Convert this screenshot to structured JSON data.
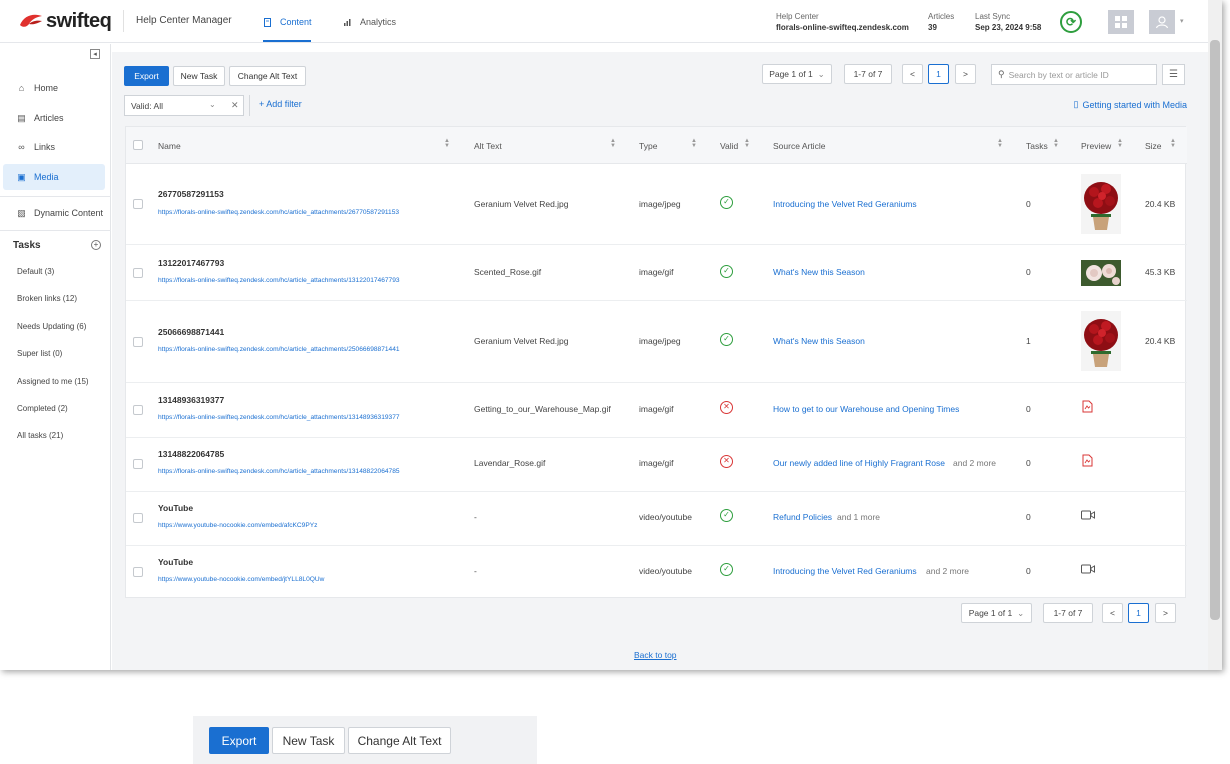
{
  "header": {
    "logo_text": "swifteq",
    "app_title": "Help Center Manager",
    "tabs": [
      {
        "label": "Content"
      },
      {
        "label": "Analytics"
      }
    ],
    "help_center": {
      "label": "Help Center",
      "value": "florals-online-swifteq.zendesk.com"
    },
    "articles": {
      "label": "Articles",
      "value": "39"
    },
    "last_sync": {
      "label": "Last Sync",
      "value": "Sep 23, 2024 9:58"
    }
  },
  "sidebar": {
    "collapse_icon": "◂",
    "items": [
      {
        "label": "Home",
        "icon": "home-icon"
      },
      {
        "label": "Articles",
        "icon": "article-icon"
      },
      {
        "label": "Links",
        "icon": "link-icon"
      },
      {
        "label": "Media",
        "icon": "media-icon"
      },
      {
        "label": "Dynamic Content",
        "icon": "dynamic-content-icon"
      }
    ],
    "tasks_title": "Tasks",
    "tasks": [
      {
        "label": "Default (3)"
      },
      {
        "label": "Broken links (12)"
      },
      {
        "label": "Needs Updating (6)"
      },
      {
        "label": "Super list (0)"
      },
      {
        "label": "Assigned to me (15)"
      },
      {
        "label": "Completed (2)"
      },
      {
        "label": "All tasks (21)"
      }
    ]
  },
  "toolbar": {
    "export_label": "Export",
    "new_task_label": "New Task",
    "change_alt_label": "Change Alt Text",
    "page_select": "Page 1 of 1",
    "range": "1-7 of 7",
    "prev": "<",
    "current_page": "1",
    "next": ">",
    "search_placeholder": "Search by text or article ID"
  },
  "filters": {
    "valid_value": "Valid: All",
    "add_filter_label": "+ Add filter",
    "getting_started_label": "Getting started with Media"
  },
  "table": {
    "columns": {
      "name": "Name",
      "alt": "Alt Text",
      "type": "Type",
      "valid": "Valid",
      "source": "Source Article",
      "tasks": "Tasks",
      "preview": "Preview",
      "size": "Size"
    },
    "rows": [
      {
        "id": "26770587291153",
        "url": "https://florals-online-swifteq.zendesk.com/hc/article_attachments/26770587291153",
        "alt": "Geranium Velvet Red.jpg",
        "type": "image/jpeg",
        "valid": true,
        "source": "Introducing the Velvet Red Geraniums",
        "more": "",
        "tasks": "0",
        "preview": "red-geranium-thumbnail",
        "size": "20.4 KB"
      },
      {
        "id": "13122017467793",
        "url": "https://florals-online-swifteq.zendesk.com/hc/article_attachments/13122017467793",
        "alt": "Scented_Rose.gif",
        "type": "image/gif",
        "valid": true,
        "source": "What's New this Season",
        "more": "",
        "tasks": "0",
        "preview": "white-rose-thumbnail",
        "size": "45.3 KB"
      },
      {
        "id": "25066698871441",
        "url": "https://florals-online-swifteq.zendesk.com/hc/article_attachments/25066698871441",
        "alt": "Geranium Velvet Red.jpg",
        "type": "image/jpeg",
        "valid": true,
        "source": "What's New this Season",
        "more": "",
        "tasks": "1",
        "preview": "red-geranium-thumbnail",
        "size": "20.4 KB"
      },
      {
        "id": "13148936319377",
        "url": "https://florals-online-swifteq.zendesk.com/hc/article_attachments/13148936319377",
        "alt": "Getting_to_our_Warehouse_Map.gif",
        "type": "image/gif",
        "valid": false,
        "source": "How to get to our Warehouse and Opening Times",
        "more": "",
        "tasks": "0",
        "preview": "broken-image-icon",
        "size": ""
      },
      {
        "id": "13148822064785",
        "url": "https://florals-online-swifteq.zendesk.com/hc/article_attachments/13148822064785",
        "alt": "Lavendar_Rose.gif",
        "type": "image/gif",
        "valid": false,
        "source": "Our newly added line of Highly Fragrant Rose",
        "more": "and 2 more",
        "tasks": "0",
        "preview": "broken-image-icon",
        "size": ""
      },
      {
        "id": "YouTube",
        "url": "https://www.youtube-nocookie.com/embed/afcKC9PYz",
        "alt": "-",
        "type": "video/youtube",
        "valid": true,
        "source": "Refund Policies",
        "more": "and 1 more",
        "tasks": "0",
        "preview": "video-icon",
        "size": ""
      },
      {
        "id": "YouTube",
        "url": "https://www.youtube-nocookie.com/embed/jtYLL8L0QUw",
        "alt": "-",
        "type": "video/youtube",
        "valid": true,
        "source": "Introducing the Velvet Red Geraniums",
        "more": "and 2 more",
        "tasks": "0",
        "preview": "video-icon",
        "size": ""
      }
    ]
  },
  "footer": {
    "page_select": "Page 1 of 1",
    "range": "1-7 of 7",
    "prev": "<",
    "current_page": "1",
    "next": ">",
    "back_to_top": "Back to top"
  },
  "zoom": {
    "export_label": "Export",
    "new_task_label": "New Task",
    "change_alt_label": "Change Alt Text"
  },
  "colors": {
    "accent": "#1a6fd1",
    "valid": "#2e9e3e",
    "invalid": "#d93636",
    "logo_red": "#e0312e"
  }
}
